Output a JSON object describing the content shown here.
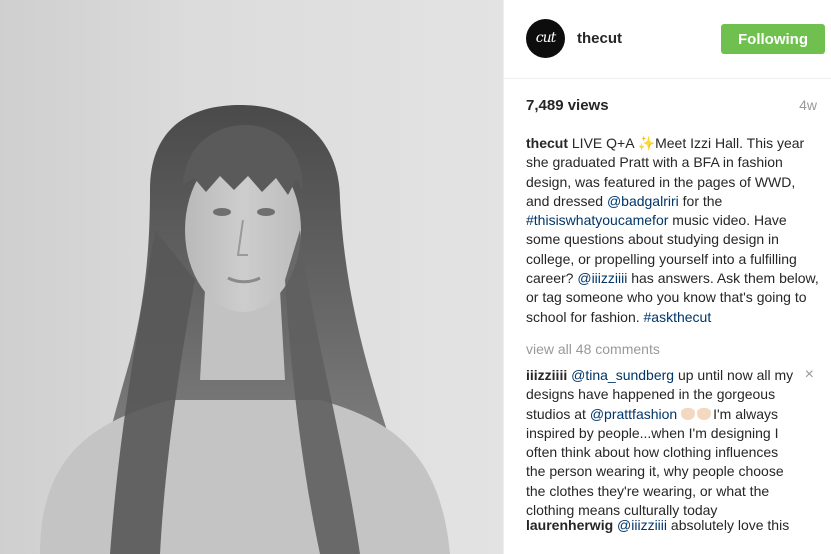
{
  "post": {
    "username": "thecut",
    "avatar_text": "cut",
    "follow_label": "Following",
    "views": "7,489 views",
    "age": "4w",
    "caption": {
      "author": "thecut",
      "text_1": " LIVE Q+A ",
      "sparkle": "✨",
      "text_2": "Meet Izzi Hall. This year she graduated Pratt with a BFA in fashion design, was featured in the pages of WWD, and dressed ",
      "mention_1": "@badgalriri",
      "text_3": " for the ",
      "hashtag_1": "#thisiswhatyoucamefor",
      "text_4": " music video. Have some questions about studying design in college, or propelling yourself into a fulfilling career? ",
      "mention_2": "@iiizziiii",
      "text_5": " has answers. Ask them below, or tag someone who you know that's going to school for fashion. ",
      "hashtag_2": "#askthecut"
    },
    "view_all_comments": "view all 48 comments",
    "comments": [
      {
        "author": "iiizziiii",
        "mention_1": "@tina_sundberg",
        "text_1": " up until now all my designs have happened in the gorgeous studios at ",
        "mention_2": "@prattfashion",
        "text_2": "I'm always inspired by people...when I'm designing I often think about how clothing influences the person wearing it, why people choose the clothes they're wearing, or what the clothing means culturally today",
        "close_icon": "×"
      },
      {
        "author": "laurenherwig",
        "mention_1": "@iiizziiii",
        "text_1": " absolutely love this"
      }
    ]
  },
  "colors": {
    "follow_bg": "#70c050",
    "link": "#003569",
    "muted": "#999999"
  }
}
